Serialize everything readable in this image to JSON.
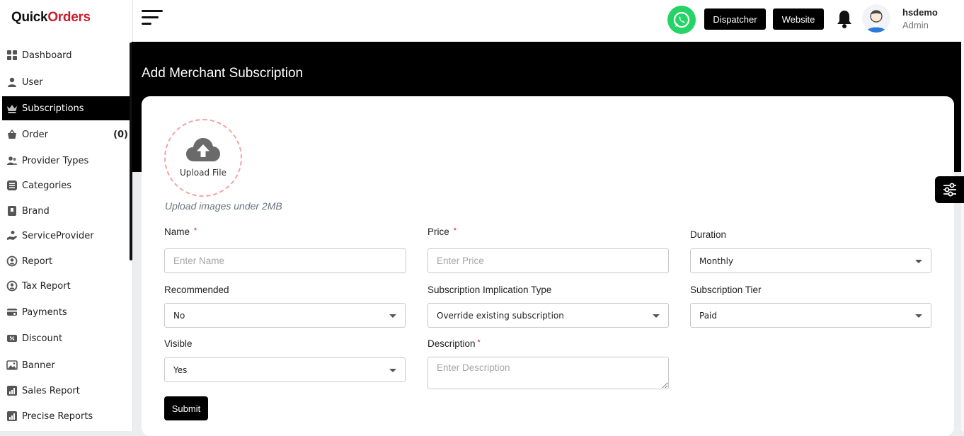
{
  "brand": {
    "name_part1": "Quick",
    "name_part2": "Orders"
  },
  "sidebar": {
    "items": [
      {
        "label": "Dashboard",
        "icon": "dashboard-icon"
      },
      {
        "label": "User",
        "icon": "user-icon"
      },
      {
        "label": "Subscriptions",
        "icon": "crown-icon",
        "active": true
      },
      {
        "label": "Order",
        "icon": "basket-icon",
        "count": "(0)"
      },
      {
        "label": "Provider Types",
        "icon": "users-icon"
      },
      {
        "label": "Categories",
        "icon": "list-icon"
      },
      {
        "label": "Brand",
        "icon": "bookmark-icon"
      },
      {
        "label": "ServiceProvider",
        "icon": "hand-icon"
      },
      {
        "label": "Report",
        "icon": "report-icon"
      },
      {
        "label": "Tax Report",
        "icon": "tax-report-icon"
      },
      {
        "label": "Payments",
        "icon": "payments-icon"
      },
      {
        "label": "Discount",
        "icon": "discount-icon"
      },
      {
        "label": "Banner",
        "icon": "image-icon"
      },
      {
        "label": "Sales Report",
        "icon": "chart-icon"
      },
      {
        "label": "Precise Reports",
        "icon": "precise-chart-icon"
      }
    ]
  },
  "header": {
    "dispatcher_label": "Dispatcher",
    "website_label": "Website",
    "user_name": "hsdemo",
    "user_role": "Admin"
  },
  "page": {
    "title": "Add Merchant Subscription"
  },
  "form": {
    "upload_label": "Upload File",
    "upload_hint": "Upload images under 2MB",
    "name_label": "Name",
    "name_placeholder": "Enter Name",
    "price_label": "Price",
    "price_placeholder": "Enter Price",
    "duration_label": "Duration",
    "duration_value": "Monthly",
    "recommended_label": "Recommended",
    "recommended_value": "No",
    "implication_label": "Subscription Implication Type",
    "implication_value": "Override existing subscription",
    "tier_label": "Subscription Tier",
    "tier_value": "Paid",
    "visible_label": "Visible",
    "visible_value": "Yes",
    "description_label": "Description",
    "description_placeholder": "Enter Description",
    "required_mark": "*",
    "submit_label": "Submit"
  },
  "colors": {
    "accent": "#000000",
    "brand_red": "#c8202e",
    "whatsapp": "#25d366",
    "required": "#d21f1f"
  }
}
